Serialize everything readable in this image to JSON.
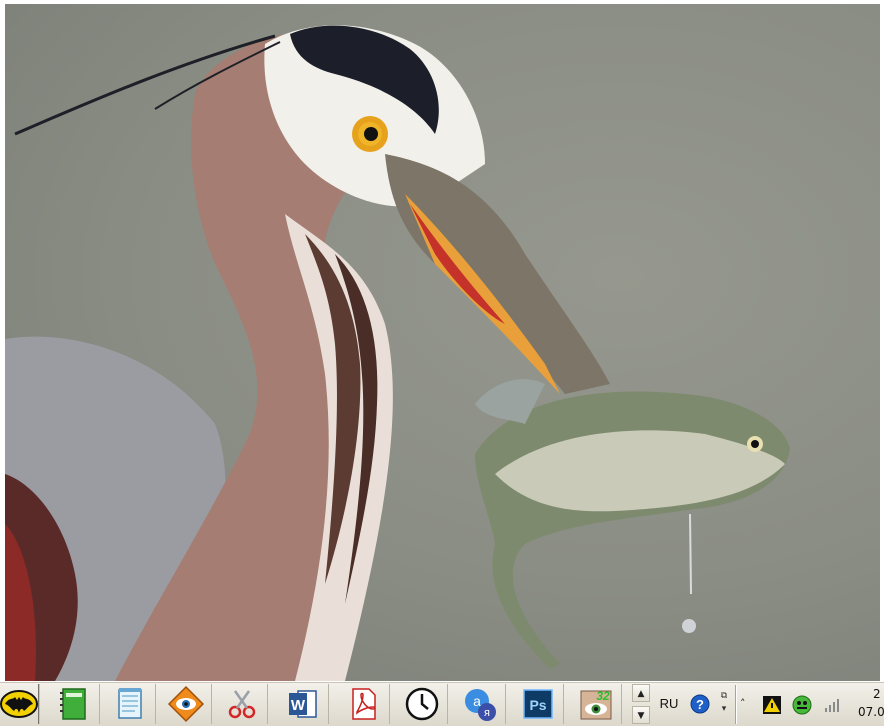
{
  "desktop": {
    "wallpaper": "great-blue-heron-catching-fish",
    "background_color": "#8a8d84"
  },
  "taskbar": {
    "start_icon": "batman-logo-icon",
    "pinned_apps": [
      {
        "icon": "green-notebook-icon"
      },
      {
        "icon": "notepad-icon"
      },
      {
        "icon": "eye-viewer-icon"
      },
      {
        "icon": "scissors-icon"
      },
      {
        "icon": "word-icon",
        "label": "W"
      },
      {
        "icon": "pdf-icon"
      },
      {
        "icon": "clock-icon"
      },
      {
        "icon": "yandex-browser-icon"
      },
      {
        "icon": "photoshop-icon",
        "label": "Ps"
      },
      {
        "icon": "eye-32-icon",
        "label": "32"
      }
    ],
    "language": "RU",
    "clock": {
      "time": "2",
      "date": "07.0"
    }
  },
  "colors": {
    "taskbar_bg": "#e8e5dc",
    "word_blue": "#2b5797",
    "photoshop_blue": "#0d3b66",
    "pdf_red": "#c8201e"
  }
}
